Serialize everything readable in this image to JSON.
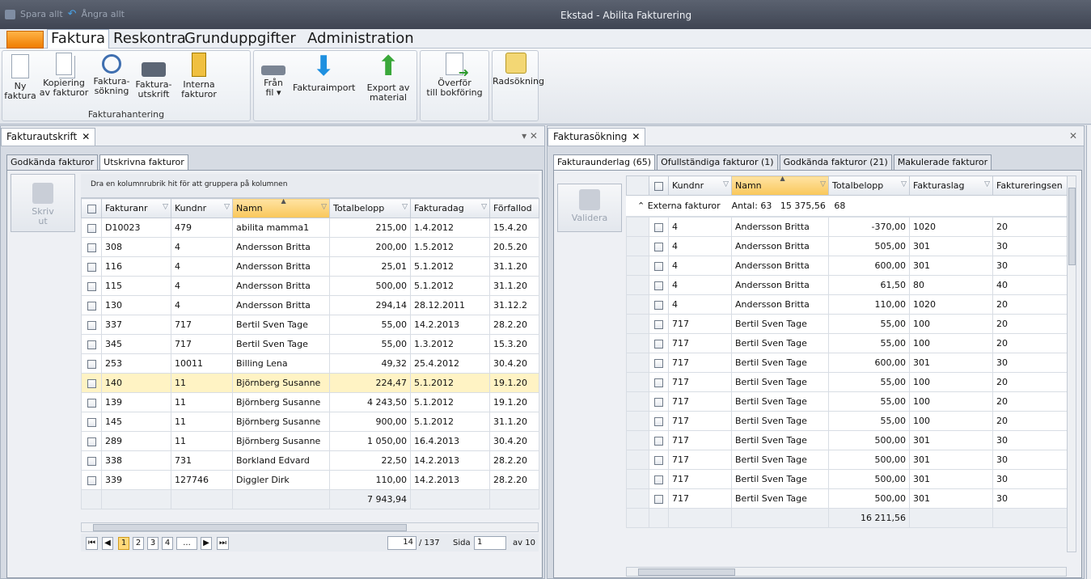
{
  "titlebar": {
    "save_all": "Spara allt",
    "undo_all": "Ångra allt",
    "window_title": "Ekstad - Abilita Fakturering"
  },
  "menu": {
    "items": [
      "Faktura",
      "Reskontra",
      "Grunduppgifter",
      "Administration"
    ],
    "active": "Faktura"
  },
  "ribbon": {
    "group1_label": "Fakturahantering",
    "buttons": [
      {
        "line1": "Ny",
        "line2": "faktura",
        "icon": "new-document-icon"
      },
      {
        "line1": "Kopiering",
        "line2": "av fakturor",
        "icon": "copy-documents-icon"
      },
      {
        "line1": "Faktura-",
        "line2": "sökning",
        "icon": "search-icon"
      },
      {
        "line1": "Faktura-",
        "line2": "utskrift",
        "icon": "printer-icon"
      },
      {
        "line1": "Interna",
        "line2": "fakturor",
        "icon": "internal-invoice-icon"
      },
      {
        "line1": "Från",
        "line2": "fil ▾",
        "icon": "file-drive-icon"
      },
      {
        "line1": "Fakturaimport",
        "line2": "",
        "icon": "import-arrow-icon"
      },
      {
        "line1": "Export av",
        "line2": "material",
        "icon": "export-arrow-icon"
      },
      {
        "line1": "Överför",
        "line2": "till bokföring",
        "icon": "transfer-document-icon"
      },
      {
        "line1": "Radsökning",
        "line2": "",
        "icon": "row-search-icon"
      }
    ]
  },
  "left_pane": {
    "tab_title": "Fakturautskrift",
    "subtabs": [
      "Godkända fakturor",
      "Utskrivna fakturor"
    ],
    "active_subtab": 1,
    "side_button": {
      "line1": "Skriv",
      "line2": "ut"
    },
    "group_hint": "Dra en kolumnrubrik hit för att gruppera på kolumnen",
    "columns": [
      "Fakturanr",
      "Kundnr",
      "Namn",
      "Totalbelopp",
      "Fakturadag",
      "Förfallod"
    ],
    "rows": [
      [
        "D10023",
        "479",
        "abilita mamma1",
        "215,00",
        "1.4.2012",
        "15.4.20"
      ],
      [
        "308",
        "4",
        "Andersson Britta",
        "200,00",
        "1.5.2012",
        "20.5.20"
      ],
      [
        "116",
        "4",
        "Andersson Britta",
        "25,01",
        "5.1.2012",
        "31.1.20"
      ],
      [
        "115",
        "4",
        "Andersson Britta",
        "500,00",
        "5.1.2012",
        "31.1.20"
      ],
      [
        "130",
        "4",
        "Andersson Britta",
        "294,14",
        "28.12.2011",
        "31.12.2"
      ],
      [
        "337",
        "717",
        "Bertil Sven Tage",
        "55,00",
        "14.2.2013",
        "28.2.20"
      ],
      [
        "345",
        "717",
        "Bertil Sven Tage",
        "55,00",
        "1.3.2012",
        "15.3.20"
      ],
      [
        "253",
        "10011",
        "Billing Lena",
        "49,32",
        "25.4.2012",
        "30.4.20"
      ],
      [
        "140",
        "11",
        "Björnberg Susanne",
        "224,47",
        "5.1.2012",
        "19.1.20"
      ],
      [
        "139",
        "11",
        "Björnberg Susanne",
        "4 243,50",
        "5.1.2012",
        "19.1.20"
      ],
      [
        "145",
        "11",
        "Björnberg Susanne",
        "900,00",
        "5.1.2012",
        "31.1.20"
      ],
      [
        "289",
        "11",
        "Björnberg Susanne",
        "1 050,00",
        "16.4.2013",
        "30.4.20"
      ],
      [
        "338",
        "731",
        "Borkland Edvard",
        "22,50",
        "14.2.2013",
        "28.2.20"
      ],
      [
        "339",
        "127746",
        "Diggler Dirk",
        "110,00",
        "14.2.2013",
        "28.2.20"
      ]
    ],
    "selected_row": 8,
    "total": "7 943,94",
    "pager": {
      "pages": [
        "1",
        "2",
        "3",
        "4",
        "..."
      ],
      "current": "1",
      "record": "14",
      "of_records": "/ 137",
      "page_label": "Sida",
      "page_value": "1",
      "of_pages": "av 10"
    }
  },
  "right_pane": {
    "tab_title": "Fakturasökning",
    "subtabs": [
      "Fakturaunderlag (65)",
      "Ofullständiga fakturor (1)",
      "Godkända fakturor (21)",
      "Makulerade fakturor"
    ],
    "active_subtab": 0,
    "side_button": {
      "line1": "Validera"
    },
    "columns": [
      "Kundnr",
      "Namn",
      "Totalbelopp",
      "Fakturaslag",
      "Faktureringsen"
    ],
    "group_row": "Externa fakturor    Antal: 63   15 375,56   68",
    "rows": [
      [
        "4",
        "Andersson Britta",
        "-370,00",
        "1020",
        "20"
      ],
      [
        "4",
        "Andersson Britta",
        "505,00",
        "301",
        "30"
      ],
      [
        "4",
        "Andersson Britta",
        "600,00",
        "301",
        "30"
      ],
      [
        "4",
        "Andersson Britta",
        "61,50",
        "80",
        "40"
      ],
      [
        "4",
        "Andersson Britta",
        "110,00",
        "1020",
        "20"
      ],
      [
        "717",
        "Bertil Sven Tage",
        "55,00",
        "100",
        "20"
      ],
      [
        "717",
        "Bertil Sven Tage",
        "55,00",
        "100",
        "20"
      ],
      [
        "717",
        "Bertil Sven Tage",
        "600,00",
        "301",
        "30"
      ],
      [
        "717",
        "Bertil Sven Tage",
        "55,00",
        "100",
        "20"
      ],
      [
        "717",
        "Bertil Sven Tage",
        "55,00",
        "100",
        "20"
      ],
      [
        "717",
        "Bertil Sven Tage",
        "55,00",
        "100",
        "20"
      ],
      [
        "717",
        "Bertil Sven Tage",
        "500,00",
        "301",
        "30"
      ],
      [
        "717",
        "Bertil Sven Tage",
        "500,00",
        "301",
        "30"
      ],
      [
        "717",
        "Bertil Sven Tage",
        "500,00",
        "301",
        "30"
      ],
      [
        "717",
        "Bertil Sven Tage",
        "500,00",
        "301",
        "30"
      ]
    ],
    "total": "16 211,56"
  }
}
